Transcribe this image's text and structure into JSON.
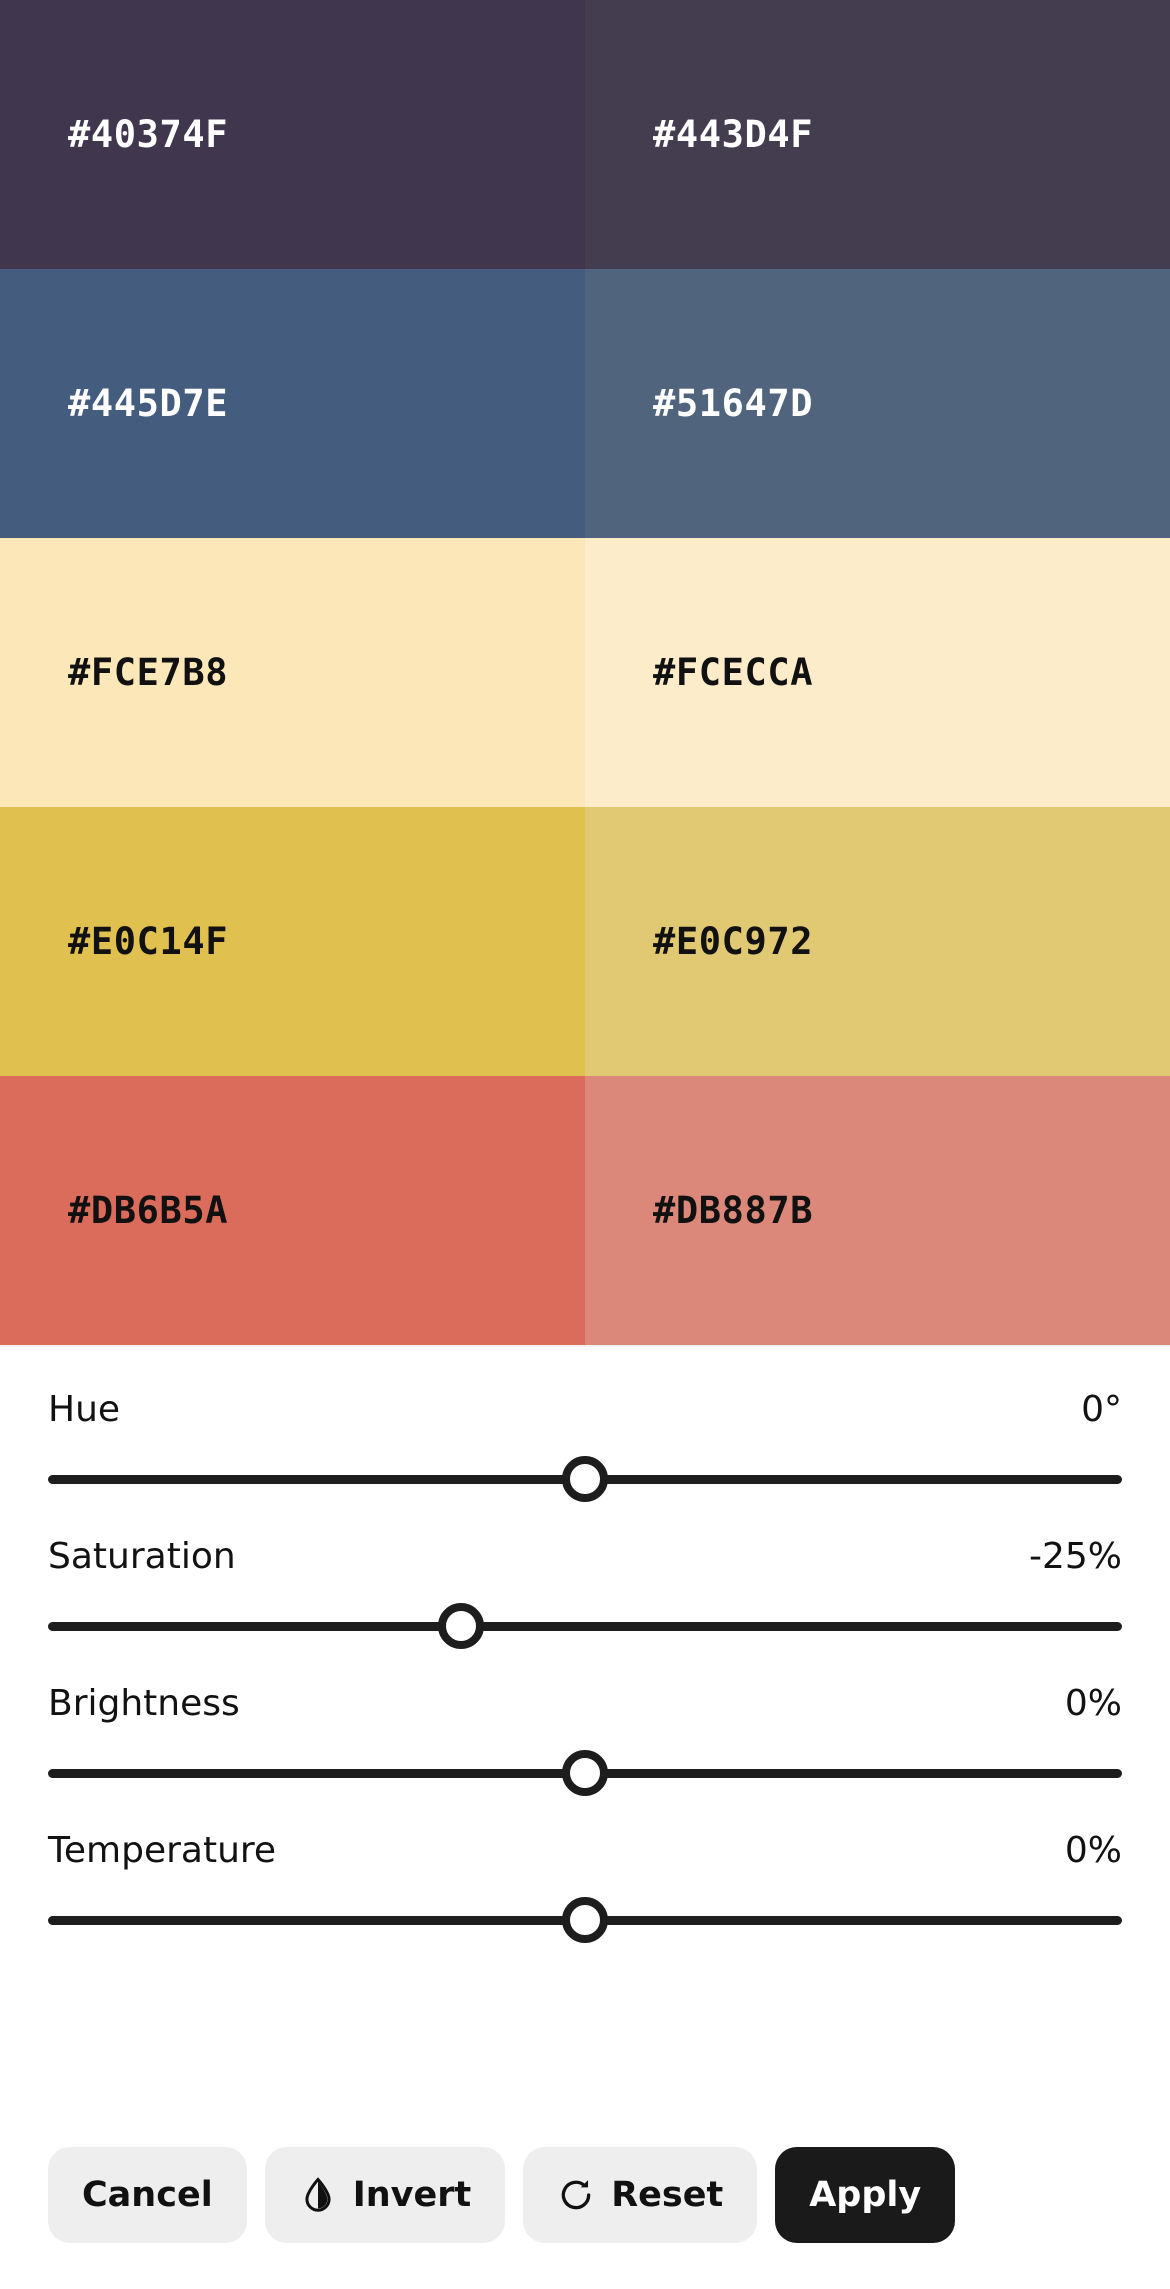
{
  "palette": {
    "rows": [
      {
        "original": {
          "hex": "#40374F",
          "label": "#40374F",
          "text_tone": "light"
        },
        "adjusted": {
          "hex": "#443D4F",
          "label": "#443D4F",
          "text_tone": "light"
        }
      },
      {
        "original": {
          "hex": "#445D7E",
          "label": "#445D7E",
          "text_tone": "light"
        },
        "adjusted": {
          "hex": "#51647D",
          "label": "#51647D",
          "text_tone": "light"
        }
      },
      {
        "original": {
          "hex": "#FCE7B8",
          "label": "#FCE7B8",
          "text_tone": "dark"
        },
        "adjusted": {
          "hex": "#FCECCA",
          "label": "#FCECCA",
          "text_tone": "dark"
        }
      },
      {
        "original": {
          "hex": "#E0C14F",
          "label": "#E0C14F",
          "text_tone": "dark"
        },
        "adjusted": {
          "hex": "#E0C972",
          "label": "#E0C972",
          "text_tone": "dark"
        }
      },
      {
        "original": {
          "hex": "#DB6B5A",
          "label": "#DB6B5A",
          "text_tone": "dark"
        },
        "adjusted": {
          "hex": "#DB887B",
          "label": "#DB887B",
          "text_tone": "dark"
        }
      }
    ]
  },
  "sliders": [
    {
      "name": "Hue",
      "value": "0°",
      "thumb_percent": 50
    },
    {
      "name": "Saturation",
      "value": "-25%",
      "thumb_percent": 38.5
    },
    {
      "name": "Brightness",
      "value": "0%",
      "thumb_percent": 50
    },
    {
      "name": "Temperature",
      "value": "0%",
      "thumb_percent": 50
    }
  ],
  "actions": {
    "cancel": "Cancel",
    "invert": "Invert",
    "reset": "Reset",
    "apply": "Apply"
  },
  "colors": {
    "accent_dark": "#1a1a1a",
    "button_secondary_bg": "#eeeeee",
    "panel_bg": "#ffffff"
  }
}
